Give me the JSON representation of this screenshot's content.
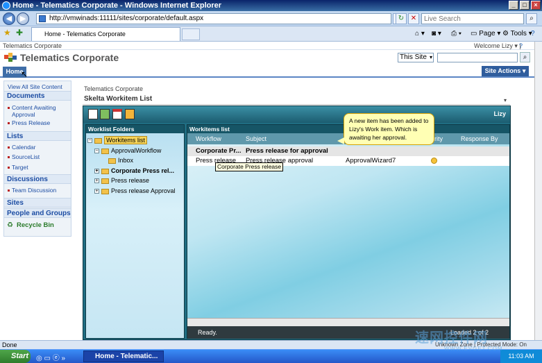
{
  "window": {
    "title": "Home - Telematics Corporate - Windows Internet Explorer",
    "min": "_",
    "max": "□",
    "close": "×"
  },
  "browser": {
    "url": "http://vmwinads:11111/sites/corporate/default.aspx",
    "live_search_placeholder": "Live Search",
    "tab_title": "Home - Telematics Corporate",
    "page_label": "Page",
    "tools_label": "Tools",
    "status_text": "Done"
  },
  "sharepoint": {
    "top_link": "Telematics Corporate",
    "welcome": "Welcome Lizy ▾ |",
    "site_title": "Telematics Corporate",
    "search_scope": "This Site",
    "home_tab": "Home",
    "site_actions": "Site Actions ▾",
    "breadcrumb": "Telematics Corporate",
    "webpart_title": "Skelta Workitem List",
    "leftnav": {
      "view_all": "View All Site Content",
      "documents": "Documents",
      "doc_items": [
        "Content Awaiting Approval",
        "Press Release"
      ],
      "lists": "Lists",
      "list_items": [
        "Calendar",
        "SourceList",
        "Target"
      ],
      "discussions": "Discussions",
      "discussion_items": [
        "Team Discussion"
      ],
      "sites": "Sites",
      "people": "People and Groups",
      "recycle": "Recycle Bin"
    }
  },
  "skelta": {
    "user": "Lizy",
    "folders_header": "Worklist Folders",
    "tree": [
      "Workitems list",
      "ApprovalWorkflow",
      "Inbox",
      "Corporate Press rel...",
      "Press release",
      "Press release Approval"
    ],
    "list_header": "Workitems list",
    "columns": [
      "Workflow",
      "Subject",
      "rity",
      "Response By"
    ],
    "group_row": {
      "workflow": "Corporate Pr...",
      "subject": "Press release for approval"
    },
    "row1": {
      "workflow": "Press release",
      "subject": "Press release approval",
      "from": "ApprovalWizard7"
    },
    "status": "Ready.",
    "loaded": "Loaded 2 of 2",
    "unknown": "Unknown Zone | Protected Mode: On"
  },
  "tooltip": "Corporate Press release",
  "callout": "A new item has been added to Lizy's Work item. Which is awaiting her approval.",
  "taskbar": {
    "start": "Start",
    "item": "Home - Telematic...",
    "clock": "11:03 AM"
  },
  "watermark": "速网控件网",
  "watermark_sub": "WWW.EVGET.COM",
  "colors": {
    "accent": "#1f6d82",
    "sharepoint_blue": "#2f5d9d",
    "callout": "#ffffb4"
  }
}
